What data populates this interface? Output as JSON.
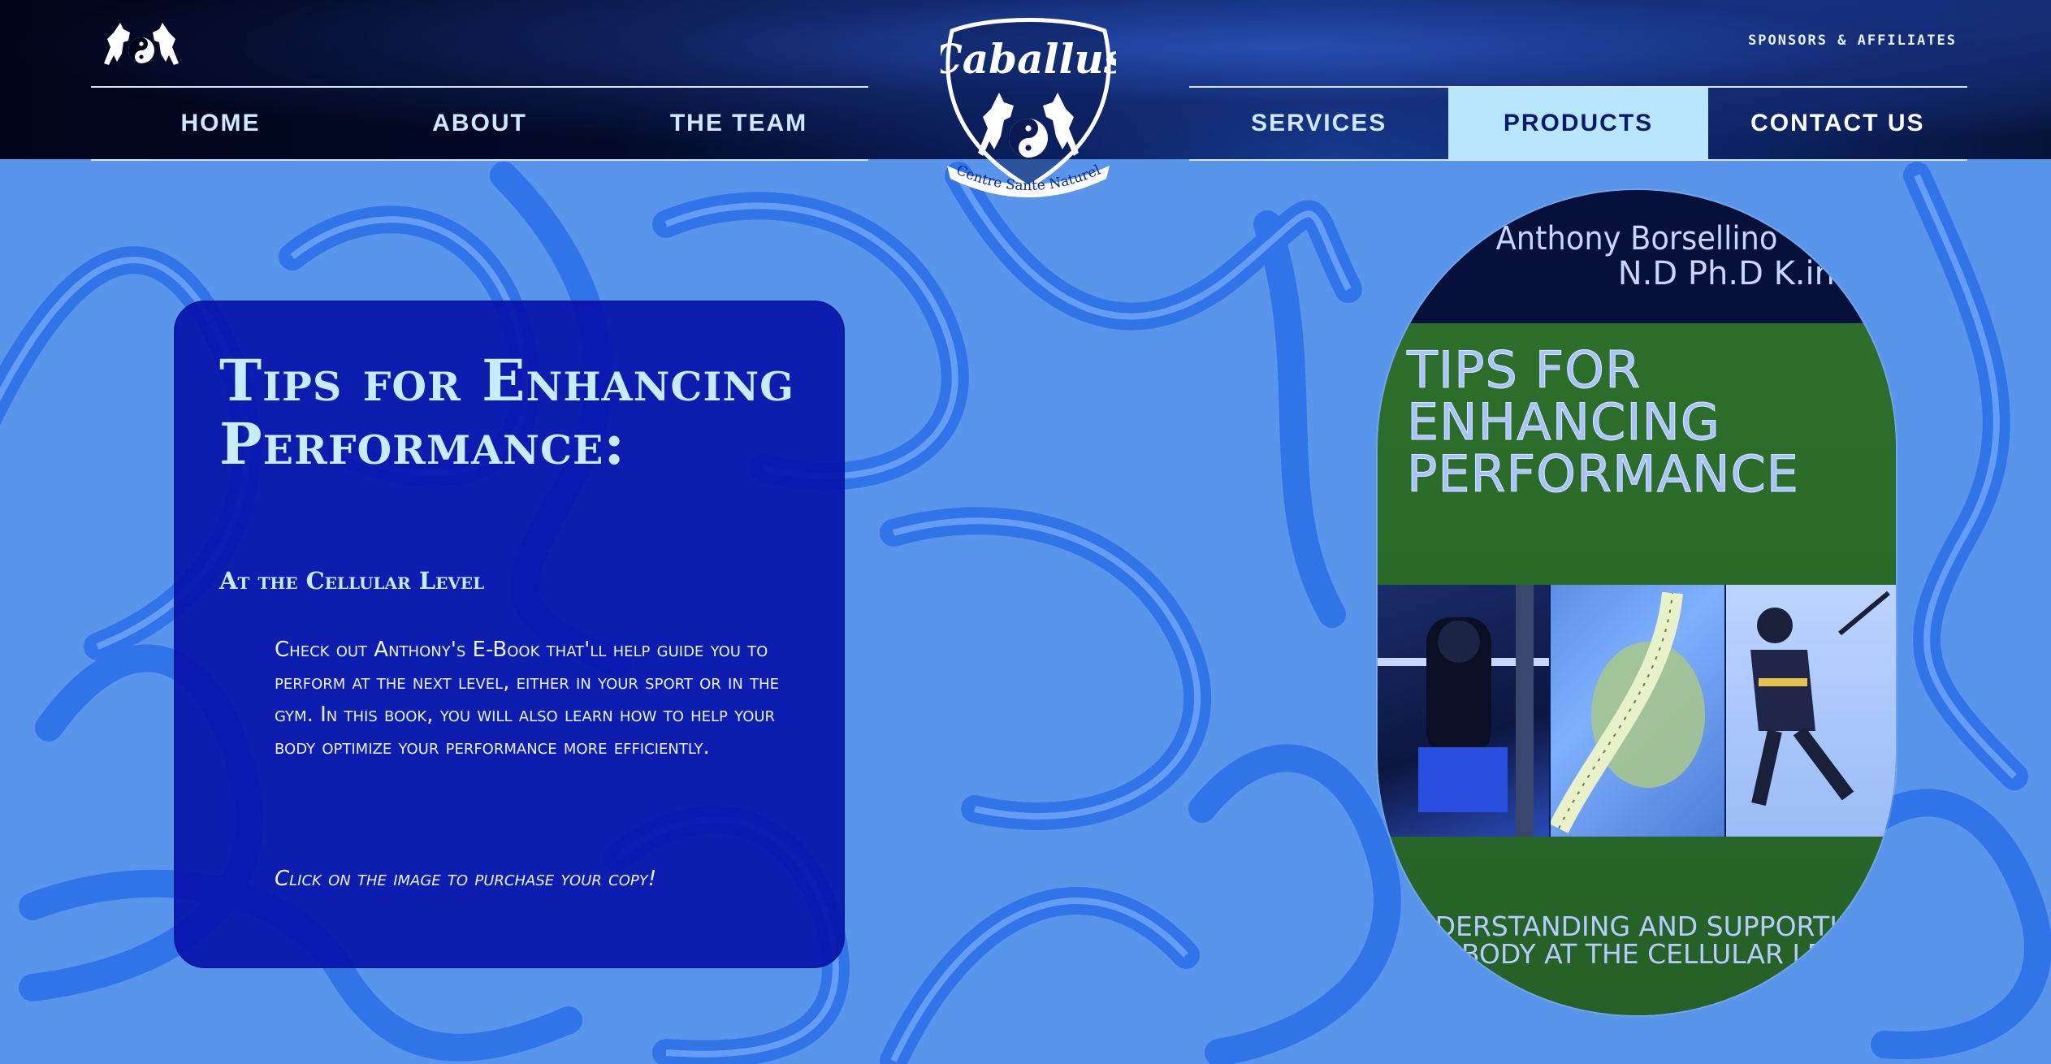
{
  "header": {
    "sponsors_link": "SPONSORS & AFFILIATES",
    "nav_left": [
      "HOME",
      "ABOUT",
      "THE TEAM"
    ],
    "nav_right": [
      "SERVICES",
      "PRODUCTS",
      "CONTACT US"
    ],
    "active_item": "PRODUCTS",
    "logo": {
      "name": "Caballus",
      "tagline": "Centre Sante Naturel"
    }
  },
  "card": {
    "title": "Tips for Enhancing Performance:",
    "subtitle": "At the Cellular Level",
    "body": "Check out Anthony's E-Book that'll help guide you to perform at the next level, either in your sport or in the gym. In this book, you will also learn how to help your body optimize your performance more efficiently.",
    "cta": "Click on the image to purchase your copy!"
  },
  "ebook": {
    "author": "Anthony Borsellino",
    "credentials": "N.D Ph.D K.in",
    "title": "TIPS FOR ENHANCING PERFORMANCE",
    "tagline_line1": "UNDERSTANDING AND SUPPORTING",
    "tagline_line2": "THE BODY AT THE CELLULAR LEVEL"
  },
  "colors": {
    "page_background": "#5a95ec",
    "header_dark": "#030a28",
    "active_nav_bg": "#b9e6ff",
    "card_bg": "#0612aa",
    "heading_color": "#c6ecff",
    "ebook_green": "#2a6a28"
  }
}
